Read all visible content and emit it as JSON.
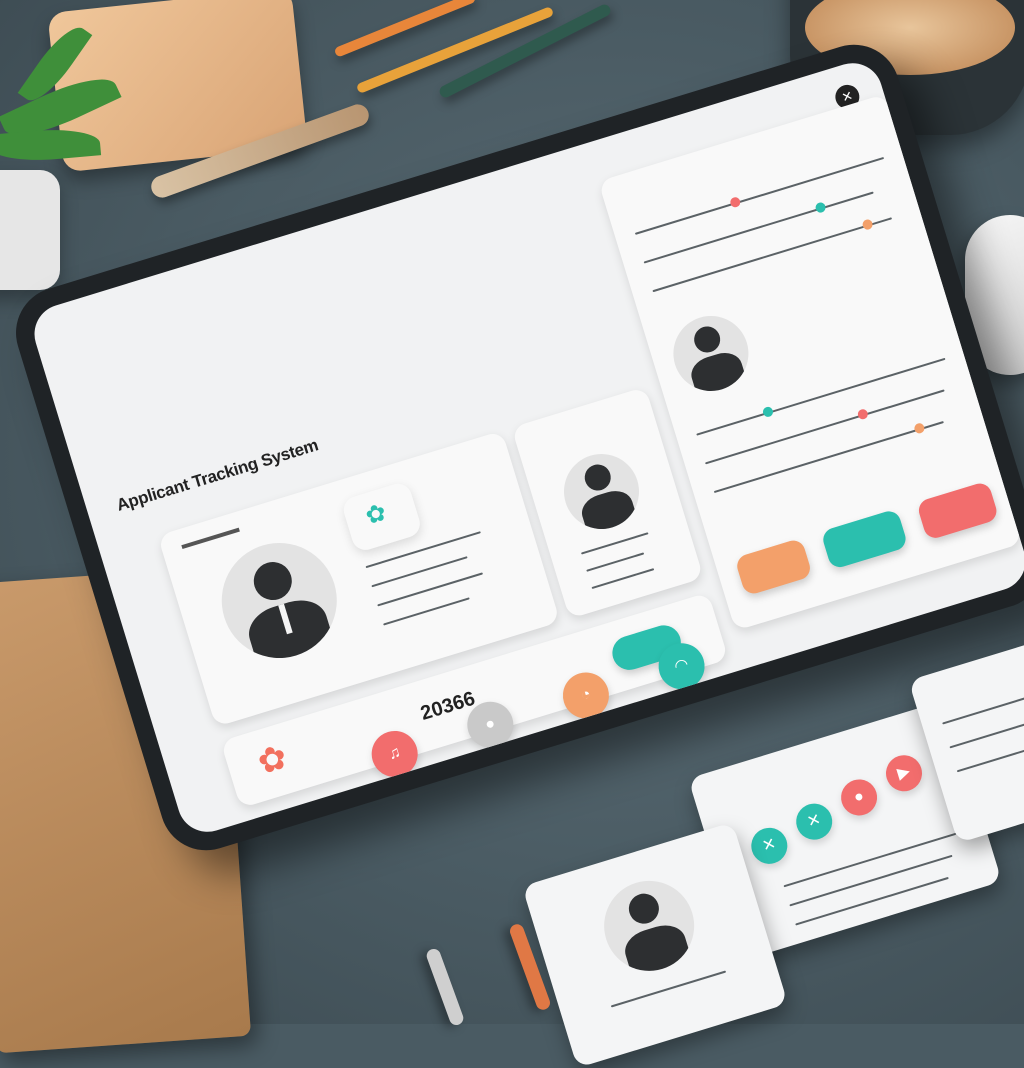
{
  "app": {
    "title": "Applicant Tracking System"
  },
  "stats": {
    "count": "20366"
  },
  "colors": {
    "teal": "#2bbfae",
    "coral": "#f26d6d",
    "orange": "#f3a06a",
    "desk": "#4a5b63"
  },
  "icons": [
    "close-icon",
    "flower-icon",
    "person-avatar-icon",
    "bell-icon",
    "search-icon",
    "chat-icon"
  ]
}
